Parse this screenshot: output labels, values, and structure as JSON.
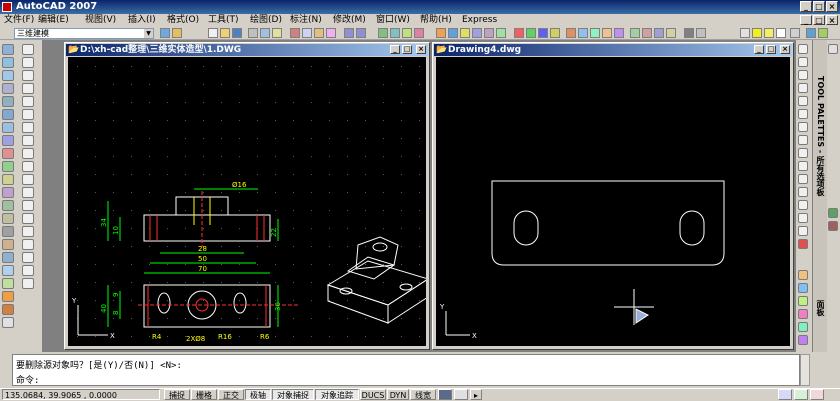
{
  "app": {
    "title": "AutoCAD 2007"
  },
  "menu": [
    "文件(F)",
    "编辑(E)",
    "视图(V)",
    "插入(I)",
    "格式(O)",
    "工具(T)",
    "绘图(D)",
    "标注(N)",
    "修改(M)",
    "窗口(W)",
    "帮助(H)",
    "Express"
  ],
  "toolbar": {
    "workspace": "三维建模"
  },
  "windows": [
    {
      "title": "D:\\xh-cad整理\\三维实体造型\\1.DWG",
      "active": true
    },
    {
      "title": "Drawing4.dwg",
      "active": false
    }
  ],
  "drawing1": {
    "dims": {
      "d1": "Ø16",
      "d2": "34",
      "d3": "10",
      "d4": "22",
      "d5": "28",
      "d6": "50",
      "d7": "70",
      "d8": "40",
      "d9": "9",
      "d10": "8",
      "d11": "R4",
      "d12": "2XØ8",
      "d13": "R16",
      "d14": "R6",
      "d15": "30"
    }
  },
  "palettes": {
    "tool_palettes": "TOOL PALETTES - 所有选项板",
    "face": "面板"
  },
  "command": {
    "line1": "要删除源对象吗？[是(Y)/否(N)] <N>:",
    "line2": "命令:"
  },
  "status": {
    "coords": "135.0684, 39.9065 , 0.0000",
    "buttons": [
      "捕捉",
      "栅格",
      "正交",
      "极轴",
      "对象捕捉",
      "对象追踪",
      "DUCS",
      "DYN",
      "线宽"
    ],
    "on": [
      false,
      false,
      false,
      true,
      true,
      true,
      false,
      false,
      false
    ]
  },
  "colors": {
    "accent": "#0a246a",
    "canvas": "#000000",
    "dim_green": "#00ff00",
    "dim_yellow": "#ffff00",
    "red": "#ff3030"
  }
}
